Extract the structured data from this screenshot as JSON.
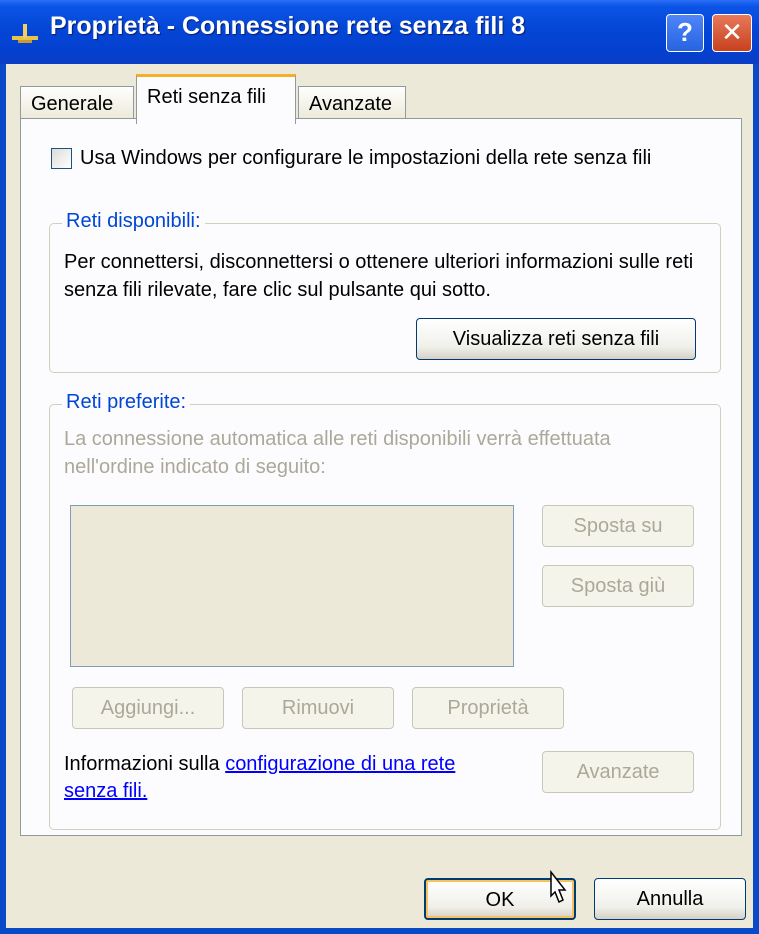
{
  "window": {
    "title": "Proprietà - Connessione rete senza fili 8",
    "help_label": "?",
    "close_label": "✕"
  },
  "tabs": [
    {
      "label": "Generale",
      "active": false
    },
    {
      "label": "Reti senza fili",
      "active": true
    },
    {
      "label": "Avanzate",
      "active": false
    }
  ],
  "use_windows_checkbox": {
    "label": "Usa Windows per configurare le impostazioni della rete senza fili",
    "checked": false
  },
  "available_networks": {
    "legend": "Reti disponibili:",
    "description": "Per connettersi, disconnettersi o ottenere ulteriori informazioni sulle reti senza fili rilevate, fare clic sul pulsante qui sotto.",
    "view_button": "Visualizza reti senza fili"
  },
  "preferred_networks": {
    "legend": "Reti preferite:",
    "description": "La connessione automatica alle reti disponibili verrà effettuata nell'ordine indicato di seguito:",
    "move_up_button": "Sposta su",
    "move_down_button": "Sposta giù",
    "add_button": "Aggiungi...",
    "remove_button": "Rimuovi",
    "properties_button": "Proprietà",
    "info_prefix": "Informazioni sulla ",
    "info_link": "configurazione di una rete senza fili.",
    "advanced_button": "Avanzate"
  },
  "footer": {
    "ok_button": "OK",
    "cancel_button": "Annulla"
  },
  "colors": {
    "titlebar": "#0446d6",
    "legend_text": "#0046d5",
    "disabled_text": "#aca899",
    "link": "#0000ff"
  }
}
